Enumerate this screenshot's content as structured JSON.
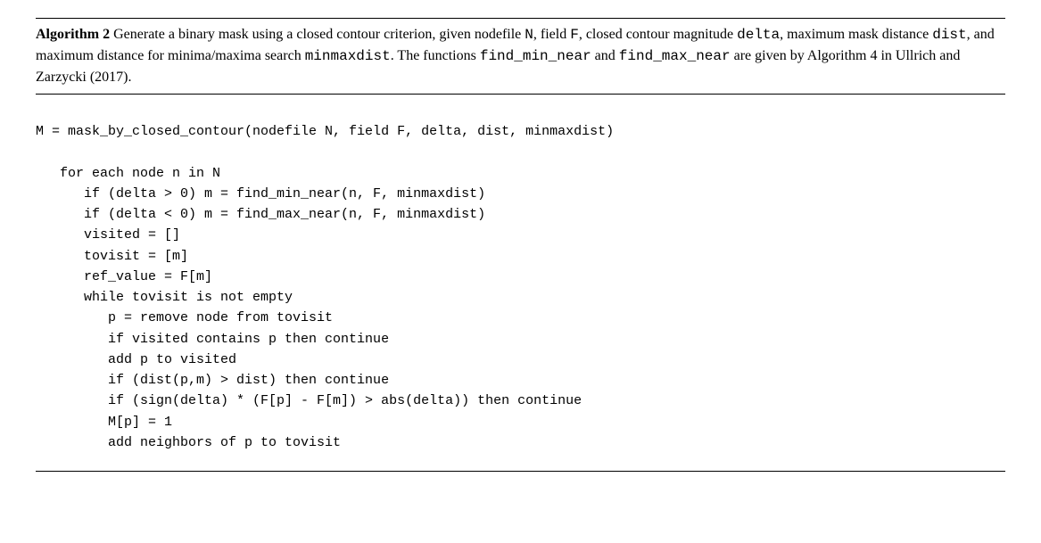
{
  "algorithm": {
    "title_label": "Algorithm 2",
    "caption_part1": " Generate a binary mask using a closed contour criterion, given nodefile ",
    "tt_N": "N",
    "caption_part2": ", field ",
    "tt_F": "F",
    "caption_part3": ", closed contour magnitude ",
    "tt_delta": "delta",
    "caption_part4": ", maximum mask distance ",
    "tt_dist": "dist",
    "caption_part5": ", and maximum distance for minima/maxima search ",
    "tt_minmaxdist": "minmaxdist",
    "caption_part6": ". The functions ",
    "tt_findmin": "find_min_near",
    "caption_part7": " and ",
    "tt_findmax": "find_max_near",
    "caption_part8": " are given by Algorithm 4 in Ullrich and Zarzycki (2017).",
    "code": "M = mask_by_closed_contour(nodefile N, field F, delta, dist, minmaxdist)\n\n   for each node n in N\n      if (delta > 0) m = find_min_near(n, F, minmaxdist)\n      if (delta < 0) m = find_max_near(n, F, minmaxdist)\n      visited = []\n      tovisit = [m]\n      ref_value = F[m]\n      while tovisit is not empty\n         p = remove node from tovisit\n         if visited contains p then continue\n         add p to visited\n         if (dist(p,m) > dist) then continue\n         if (sign(delta) * (F[p] - F[m]) > abs(delta)) then continue\n         M[p] = 1\n         add neighbors of p to tovisit"
  }
}
